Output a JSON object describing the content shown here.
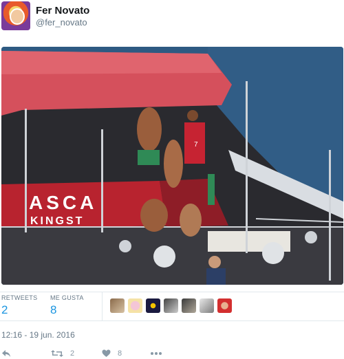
{
  "user": {
    "display_name": "Fer Novato",
    "handle": "@fer_novato"
  },
  "photo": {
    "boat_lettering_top": "ASCA",
    "boat_lettering_bottom": "KINGST",
    "player_number": "7"
  },
  "stats": {
    "retweets_label": "RETWEETS",
    "retweets_count": "2",
    "likes_label": "ME GUSTA",
    "likes_count": "8"
  },
  "timestamp": "12:16 - 19 jun. 2016",
  "actions": {
    "reply_icon": "reply-icon",
    "retweet_icon": "retweet-icon",
    "retweet_count": "2",
    "like_icon": "heart-icon",
    "like_count": "8",
    "more_icon": "more-icon"
  },
  "colors": {
    "link_blue": "#1b95e0",
    "muted": "#657786",
    "awning": "#d5505c",
    "sea": "#2f5e86"
  }
}
